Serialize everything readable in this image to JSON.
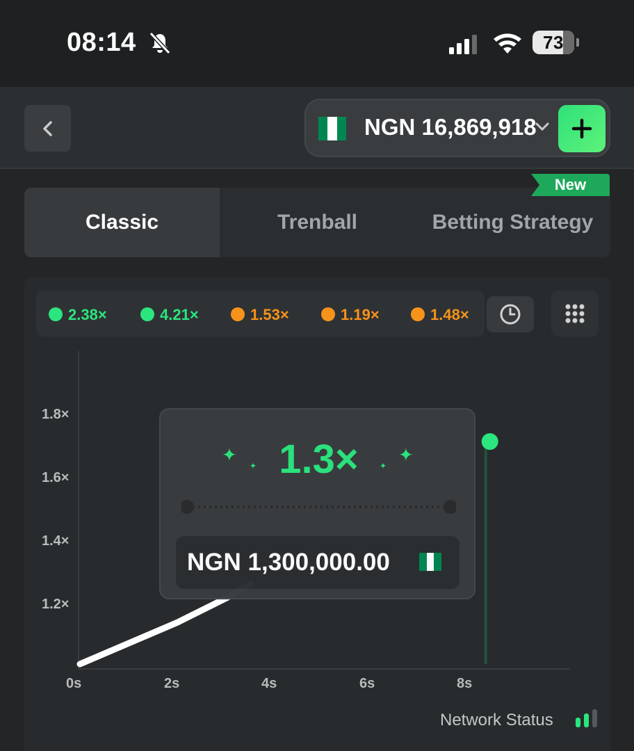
{
  "status_bar": {
    "time": "08:14",
    "battery": "73",
    "icons": [
      "bell-slash-icon",
      "cellular-signal-icon",
      "wifi-icon",
      "battery-icon"
    ]
  },
  "header": {
    "back_icon": "chevron-left-icon",
    "balance": "NGN 16,869,918",
    "currency_flag": "nigeria-flag",
    "dropdown_icon": "chevron-down-icon",
    "deposit_icon": "plus-icon"
  },
  "tabs": {
    "items": [
      {
        "label": "Classic",
        "active": true
      },
      {
        "label": "Trenball",
        "active": false
      },
      {
        "label": "Betting Strategy",
        "active": false
      }
    ],
    "new_badge": "New"
  },
  "history": {
    "items": [
      {
        "value": "2.38×",
        "color": "#2be57e"
      },
      {
        "value": "4.21×",
        "color": "#2be57e"
      },
      {
        "value": "1.53×",
        "color": "#f7931a"
      },
      {
        "value": "1.19×",
        "color": "#f7931a"
      },
      {
        "value": "1.48×",
        "color": "#f7931a"
      }
    ],
    "history_icon": "clock-icon",
    "menu_icon": "grid-dots-icon"
  },
  "chart_data": {
    "type": "line",
    "y_ticks": [
      "1.8×",
      "1.6×",
      "1.4×",
      "1.2×"
    ],
    "x_ticks": [
      "0s",
      "2s",
      "4s",
      "6s",
      "8s"
    ],
    "xlim": [
      0,
      10
    ],
    "ylim": [
      1.0,
      1.9
    ],
    "series": [
      {
        "x": [
          0,
          1,
          2,
          3,
          3.5
        ],
        "y": [
          1.0,
          1.06,
          1.12,
          1.19,
          1.23
        ]
      }
    ],
    "current_point": {
      "x": 8.4,
      "y": 1.64
    },
    "colors": {
      "line": "#ffffff",
      "point": "#2be57e"
    }
  },
  "result": {
    "multiplier": "1.3×",
    "amount": "NGN 1,300,000.00"
  },
  "footer": {
    "network_status": "Network Status",
    "network_icon": "signal-bars-icon"
  },
  "colors": {
    "accent": "#2be57e",
    "background": "#232526",
    "panel": "#282b2d",
    "flag_green": "#008751",
    "flag_white": "#ffffff"
  }
}
